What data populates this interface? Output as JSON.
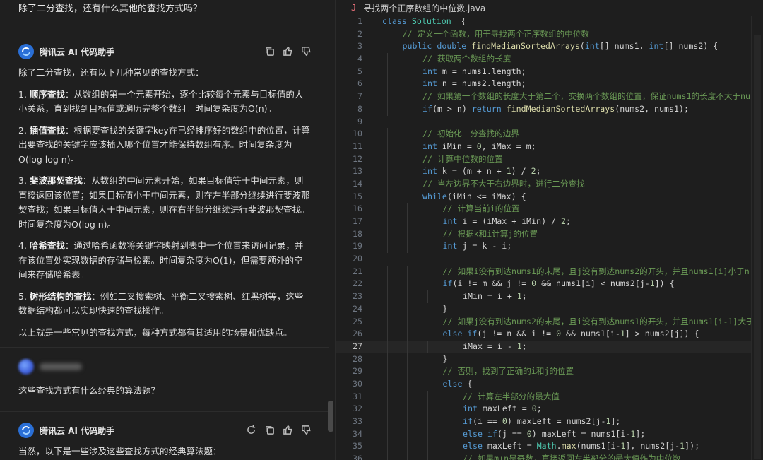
{
  "chat": {
    "first_question": "除了二分查找，还有什么其他的查找方式吗？",
    "bot_name": "腾讯云 AI 代码助手",
    "answer_intro": "除了二分查找，还有以下几种常见的查找方式：",
    "methods": [
      {
        "num": "1. ",
        "name": "顺序查找",
        "desc": "：从数组的第一个元素开始，逐个比较每个元素与目标值的大小关系，直到找到目标值或遍历完整个数组。时间复杂度为O(n)。"
      },
      {
        "num": "2. ",
        "name": "插值查找",
        "desc": "：根据要查找的关键字key在已经排序好的数组中的位置，计算出要查找的关键字应该插入哪个位置才能保持数组有序。时间复杂度为O(log log n)。"
      },
      {
        "num": "3. ",
        "name": "斐波那契查找",
        "desc": "：从数组的中间元素开始，如果目标值等于中间元素，则直接返回该位置；如果目标值小于中间元素，则在左半部分继续进行斐波那契查找；如果目标值大于中间元素，则在右半部分继续进行斐波那契查找。时间复杂度为O(log n)。"
      },
      {
        "num": "4. ",
        "name": "哈希查找",
        "desc": "：通过哈希函数将关键字映射到表中一个位置来访问记录，并在该位置处实现数据的存储与检索。时间复杂度为O(1)，但需要额外的空间来存储哈希表。"
      },
      {
        "num": "5. ",
        "name": "树形结构的查找",
        "desc": "：例如二叉搜索树、平衡二叉搜索树、红黑树等，这些数据结构都可以实现快速的查找操作。"
      }
    ],
    "answer_outro": "以上就是一些常见的查找方式，每种方式都有其适用的场景和优缺点。",
    "second_question": "这些查找方式有什么经典的算法题？",
    "second_bot_name": "腾讯云 AI 代码助手",
    "second_answer_start": "当然，以下是一些涉及这些查找方式的经典算法题："
  },
  "editor": {
    "tab_icon": "J",
    "tab_title": "寻找两个正序数组的中位数.java",
    "active_line": 27,
    "lines": [
      {
        "n": "1",
        "indent": 0,
        "parts": [
          [
            "kw",
            "class "
          ],
          [
            "ty",
            "Solution"
          ],
          [
            "",
            "  {"
          ]
        ]
      },
      {
        "n": "2",
        "indent": 1,
        "parts": [
          [
            "cm",
            "// 定义一个函数，用于寻找两个正序数组的中位数"
          ]
        ]
      },
      {
        "n": "3",
        "indent": 1,
        "parts": [
          [
            "kw",
            "public double "
          ],
          [
            "fn",
            "findMedianSortedArrays"
          ],
          [
            "",
            "("
          ],
          [
            "kw",
            "int"
          ],
          [
            "",
            "[] nums1, "
          ],
          [
            "kw",
            "int"
          ],
          [
            "",
            "[] nums2) {"
          ]
        ]
      },
      {
        "n": "4",
        "indent": 2,
        "parts": [
          [
            "cm",
            "// 获取两个数组的长度"
          ]
        ]
      },
      {
        "n": "5",
        "indent": 2,
        "parts": [
          [
            "kw",
            "int"
          ],
          [
            "",
            " m = nums1.length;"
          ]
        ]
      },
      {
        "n": "6",
        "indent": 2,
        "parts": [
          [
            "kw",
            "int"
          ],
          [
            "",
            " n = nums2.length;"
          ]
        ]
      },
      {
        "n": "7",
        "indent": 2,
        "parts": [
          [
            "cm",
            "// 如果第一个数组的长度大于第二个，交换两个数组的位置，保证nums1的长度不大于nu"
          ]
        ]
      },
      {
        "n": "8",
        "indent": 2,
        "parts": [
          [
            "kw",
            "if"
          ],
          [
            "",
            "(m > n) "
          ],
          [
            "kw",
            "return "
          ],
          [
            "fn",
            "findMedianSortedArrays"
          ],
          [
            "",
            "(nums2, nums1);"
          ]
        ]
      },
      {
        "n": "9",
        "indent": 0,
        "parts": []
      },
      {
        "n": "10",
        "indent": 2,
        "parts": [
          [
            "cm",
            "// 初始化二分查找的边界"
          ]
        ]
      },
      {
        "n": "11",
        "indent": 2,
        "parts": [
          [
            "kw",
            "int"
          ],
          [
            "",
            " iMin = "
          ],
          [
            "nu",
            "0"
          ],
          [
            "",
            ", iMax = m;"
          ]
        ]
      },
      {
        "n": "12",
        "indent": 2,
        "parts": [
          [
            "cm",
            "// 计算中位数的位置"
          ]
        ]
      },
      {
        "n": "13",
        "indent": 2,
        "parts": [
          [
            "kw",
            "int"
          ],
          [
            "",
            " k = (m + n + "
          ],
          [
            "nu",
            "1"
          ],
          [
            "",
            ") / "
          ],
          [
            "nu",
            "2"
          ],
          [
            "",
            ";"
          ]
        ]
      },
      {
        "n": "14",
        "indent": 2,
        "parts": [
          [
            "cm",
            "// 当左边界不大于右边界时，进行二分查找"
          ]
        ]
      },
      {
        "n": "15",
        "indent": 2,
        "parts": [
          [
            "kw",
            "while"
          ],
          [
            "",
            "(iMin <= iMax) {"
          ]
        ]
      },
      {
        "n": "16",
        "indent": 3,
        "parts": [
          [
            "cm",
            "// 计算当前i的位置"
          ]
        ]
      },
      {
        "n": "17",
        "indent": 3,
        "parts": [
          [
            "kw",
            "int"
          ],
          [
            "",
            " i = (iMax + iMin) / "
          ],
          [
            "nu",
            "2"
          ],
          [
            "",
            ";"
          ]
        ]
      },
      {
        "n": "18",
        "indent": 3,
        "parts": [
          [
            "cm",
            "// 根据k和i计算j的位置"
          ]
        ]
      },
      {
        "n": "19",
        "indent": 3,
        "parts": [
          [
            "kw",
            "int"
          ],
          [
            "",
            " j = k - i;"
          ]
        ]
      },
      {
        "n": "20",
        "indent": 0,
        "parts": []
      },
      {
        "n": "21",
        "indent": 3,
        "parts": [
          [
            "cm",
            "// 如果i没有到达nums1的末尾，且j没有到达nums2的开头，并且nums1[i]小于n"
          ]
        ]
      },
      {
        "n": "22",
        "indent": 3,
        "parts": [
          [
            "kw",
            "if"
          ],
          [
            "",
            "(i != m && j != "
          ],
          [
            "nu",
            "0"
          ],
          [
            "",
            " && nums1[i] < nums2[j-"
          ],
          [
            "nu",
            "1"
          ],
          [
            "",
            "]) {"
          ]
        ]
      },
      {
        "n": "23",
        "indent": 4,
        "parts": [
          [
            "",
            "iMin = i + "
          ],
          [
            "nu",
            "1"
          ],
          [
            "",
            ";"
          ]
        ]
      },
      {
        "n": "24",
        "indent": 3,
        "parts": [
          [
            "",
            "}"
          ]
        ]
      },
      {
        "n": "25",
        "indent": 3,
        "parts": [
          [
            "cm",
            "// 如果j没有到达nums2的末尾，且i没有到达nums1的开头，并且nums1[i-1]大于"
          ]
        ]
      },
      {
        "n": "26",
        "indent": 3,
        "parts": [
          [
            "kw",
            "else if"
          ],
          [
            "",
            "(j != n && i != "
          ],
          [
            "nu",
            "0"
          ],
          [
            "",
            " && nums1[i-"
          ],
          [
            "nu",
            "1"
          ],
          [
            "",
            "] > nums2[j]) {"
          ]
        ]
      },
      {
        "n": "27",
        "indent": 4,
        "parts": [
          [
            "",
            "iMax = i - "
          ],
          [
            "nu",
            "1"
          ],
          [
            "",
            ";"
          ]
        ]
      },
      {
        "n": "28",
        "indent": 3,
        "parts": [
          [
            "",
            "}"
          ]
        ]
      },
      {
        "n": "29",
        "indent": 3,
        "parts": [
          [
            "cm",
            "// 否则，找到了正确的i和j的位置"
          ]
        ]
      },
      {
        "n": "30",
        "indent": 3,
        "parts": [
          [
            "kw",
            "else"
          ],
          [
            "",
            " {"
          ]
        ]
      },
      {
        "n": "31",
        "indent": 4,
        "parts": [
          [
            "cm",
            "// 计算左半部分的最大值"
          ]
        ]
      },
      {
        "n": "32",
        "indent": 4,
        "parts": [
          [
            "kw",
            "int"
          ],
          [
            "",
            " maxLeft = "
          ],
          [
            "nu",
            "0"
          ],
          [
            "",
            ";"
          ]
        ]
      },
      {
        "n": "33",
        "indent": 4,
        "parts": [
          [
            "kw",
            "if"
          ],
          [
            "",
            "(i == "
          ],
          [
            "nu",
            "0"
          ],
          [
            "",
            ") maxLeft = nums2[j-"
          ],
          [
            "nu",
            "1"
          ],
          [
            "",
            "];"
          ]
        ]
      },
      {
        "n": "34",
        "indent": 4,
        "parts": [
          [
            "kw",
            "else if"
          ],
          [
            "",
            "(j == "
          ],
          [
            "nu",
            "0"
          ],
          [
            "",
            ") maxLeft = nums1[i-"
          ],
          [
            "nu",
            "1"
          ],
          [
            "",
            "];"
          ]
        ]
      },
      {
        "n": "35",
        "indent": 4,
        "parts": [
          [
            "kw",
            "else"
          ],
          [
            "",
            " maxLeft = "
          ],
          [
            "ty",
            "Math"
          ],
          [
            "",
            "."
          ],
          [
            "fn",
            "max"
          ],
          [
            "",
            "(nums1[i-"
          ],
          [
            "nu",
            "1"
          ],
          [
            "",
            "], nums2[j-"
          ],
          [
            "nu",
            "1"
          ],
          [
            "",
            "]);"
          ]
        ]
      },
      {
        "n": "36",
        "indent": 4,
        "parts": [
          [
            "cm",
            "// 如果m+n是奇数，直接返回左半部分的最大值作为中位数"
          ]
        ]
      }
    ]
  }
}
